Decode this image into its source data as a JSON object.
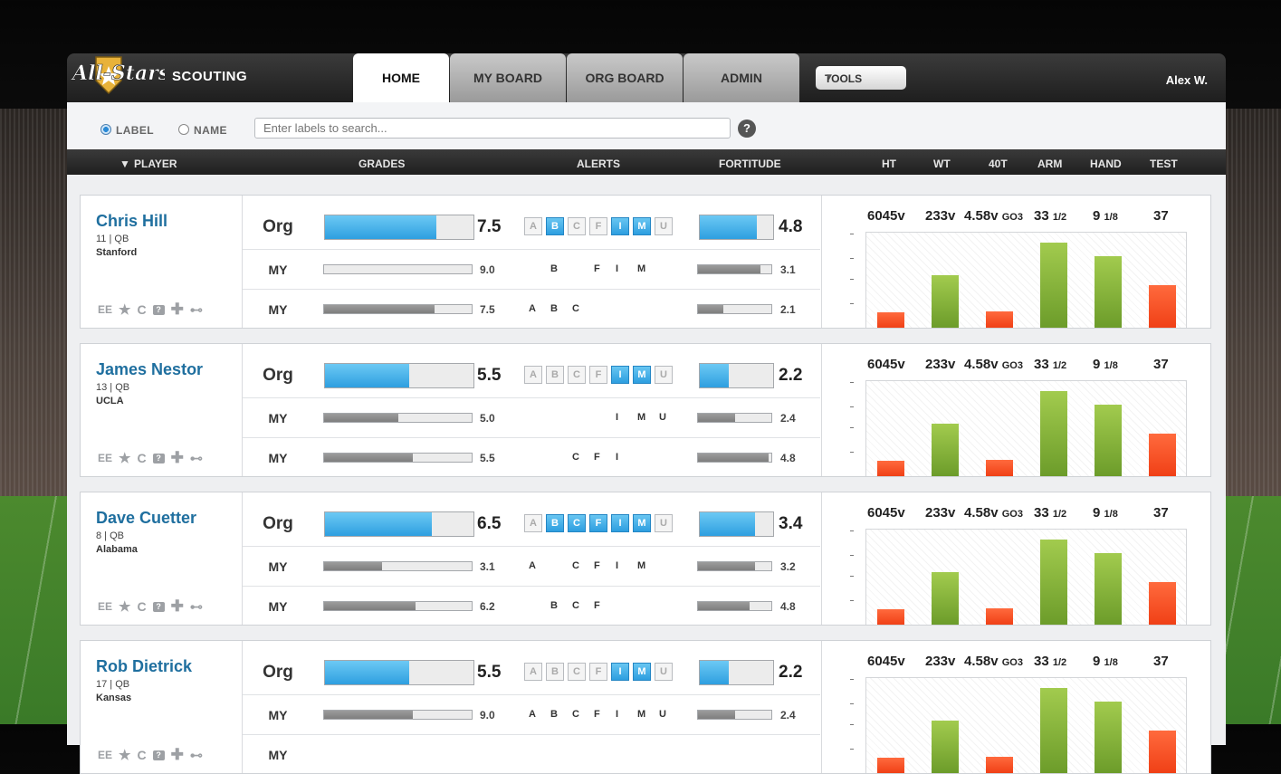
{
  "app": {
    "brand": "SCOUTING",
    "logo_text": "All-Stars",
    "user": "Alex W."
  },
  "tabs": [
    {
      "label": "HOME",
      "active": true
    },
    {
      "label": "MY BOARD",
      "active": false
    },
    {
      "label": "ORG BOARD",
      "active": false
    },
    {
      "label": "ADMIN",
      "active": false
    }
  ],
  "tools": {
    "label": "TOOLS"
  },
  "search": {
    "radio_label": "LABEL",
    "radio_name": "NAME",
    "selected": "LABEL",
    "placeholder": "Enter labels to search...",
    "help": "?"
  },
  "columns": {
    "player": "PLAYER",
    "grades": "GRADES",
    "alerts": "ALERTS",
    "fortitude": "FORTITUDE",
    "ht": "HT",
    "wt": "WT",
    "forty": "40T",
    "arm": "ARM",
    "hand": "HAND",
    "test": "TEST"
  },
  "row_labels": {
    "org": "Org",
    "my": "MY"
  },
  "player_icons": {
    "ee": "EE",
    "c": "C"
  },
  "alert_letters": [
    "A",
    "B",
    "C",
    "F",
    "I",
    "M",
    "U"
  ],
  "colors": {
    "accent_blue": "#2e9fe0",
    "bar_red": "#f04016",
    "bar_green": "#6c9c2a",
    "name_blue": "#1f6f9f"
  },
  "players": [
    {
      "name": "Chris Hill",
      "number_pos": "11 | QB",
      "school": "Stanford",
      "org": {
        "grade": "7.5",
        "grade_pct": 75,
        "alerts_on": [
          "B",
          "I",
          "M"
        ],
        "fortitude": "4.8",
        "fort_pct": 78
      },
      "my": [
        {
          "grade": "9.0",
          "grade_pct": 0,
          "letters": [
            "B",
            "F",
            "I",
            "M"
          ],
          "fortitude": "3.1",
          "fort_pct": 85
        },
        {
          "grade": "7.5",
          "grade_pct": 75,
          "letters": [
            "A",
            "B",
            "C"
          ],
          "fortitude": "2.1",
          "fort_pct": 35
        }
      ],
      "measure": {
        "ht": "6045v",
        "wt": "233v",
        "forty": "4.58v",
        "forty_tag": "GO3",
        "arm": "33",
        "arm_frac": "1/2",
        "hand": "9",
        "hand_frac": "1/8",
        "test": "37"
      },
      "chart": [
        {
          "v": 16,
          "c": "red"
        },
        {
          "v": 55,
          "c": "green"
        },
        {
          "v": 17,
          "c": "red"
        },
        {
          "v": 90,
          "c": "green"
        },
        {
          "v": 75,
          "c": "green"
        },
        {
          "v": 45,
          "c": "red"
        }
      ]
    },
    {
      "name": "James Nestor",
      "number_pos": "13 | QB",
      "school": "UCLA",
      "org": {
        "grade": "5.5",
        "grade_pct": 57,
        "alerts_on": [
          "I",
          "M"
        ],
        "fortitude": "2.2",
        "fort_pct": 40
      },
      "my": [
        {
          "grade": "5.0",
          "grade_pct": 50,
          "letters": [
            "I",
            "M",
            "U"
          ],
          "fortitude": "2.4",
          "fort_pct": 50
        },
        {
          "grade": "5.5",
          "grade_pct": 60,
          "letters": [
            "C",
            "F",
            "I"
          ],
          "fortitude": "4.8",
          "fort_pct": 96
        }
      ],
      "measure": {
        "ht": "6045v",
        "wt": "233v",
        "forty": "4.58v",
        "forty_tag": "GO3",
        "arm": "33",
        "arm_frac": "1/2",
        "hand": "9",
        "hand_frac": "1/8",
        "test": "37"
      },
      "chart": [
        {
          "v": 16,
          "c": "red"
        },
        {
          "v": 55,
          "c": "green"
        },
        {
          "v": 17,
          "c": "red"
        },
        {
          "v": 90,
          "c": "green"
        },
        {
          "v": 75,
          "c": "green"
        },
        {
          "v": 45,
          "c": "red"
        }
      ]
    },
    {
      "name": "Dave Cuetter",
      "number_pos": "8 | QB",
      "school": "Alabama",
      "org": {
        "grade": "6.5",
        "grade_pct": 72,
        "alerts_on": [
          "B",
          "C",
          "F",
          "I",
          "M"
        ],
        "fortitude": "3.4",
        "fort_pct": 75
      },
      "my": [
        {
          "grade": "3.1",
          "grade_pct": 39,
          "letters": [
            "A",
            "C",
            "F",
            "I",
            "M"
          ],
          "fortitude": "3.2",
          "fort_pct": 78
        },
        {
          "grade": "6.2",
          "grade_pct": 62,
          "letters": [
            "B",
            "C",
            "F"
          ],
          "fortitude": "4.8",
          "fort_pct": 70
        }
      ],
      "measure": {
        "ht": "6045v",
        "wt": "233v",
        "forty": "4.58v",
        "forty_tag": "GO3",
        "arm": "33",
        "arm_frac": "1/2",
        "hand": "9",
        "hand_frac": "1/8",
        "test": "37"
      },
      "chart": [
        {
          "v": 16,
          "c": "red"
        },
        {
          "v": 55,
          "c": "green"
        },
        {
          "v": 17,
          "c": "red"
        },
        {
          "v": 90,
          "c": "green"
        },
        {
          "v": 75,
          "c": "green"
        },
        {
          "v": 45,
          "c": "red"
        }
      ]
    },
    {
      "name": "Rob Dietrick",
      "number_pos": "17 | QB",
      "school": "Kansas",
      "org": {
        "grade": "5.5",
        "grade_pct": 57,
        "alerts_on": [
          "I",
          "M"
        ],
        "fortitude": "2.2",
        "fort_pct": 40
      },
      "my": [
        {
          "grade": "9.0",
          "grade_pct": 60,
          "letters": [
            "A",
            "B",
            "C",
            "F",
            "I",
            "M",
            "U"
          ],
          "fortitude": "2.4",
          "fort_pct": 50
        },
        {
          "grade": "",
          "grade_pct": 0,
          "letters": [],
          "fortitude": "",
          "fort_pct": 0
        }
      ],
      "measure": {
        "ht": "6045v",
        "wt": "233v",
        "forty": "4.58v",
        "forty_tag": "GO3",
        "arm": "33",
        "arm_frac": "1/2",
        "hand": "9",
        "hand_frac": "1/8",
        "test": "37"
      },
      "chart": [
        {
          "v": 16,
          "c": "red"
        },
        {
          "v": 55,
          "c": "green"
        },
        {
          "v": 17,
          "c": "red"
        },
        {
          "v": 90,
          "c": "green"
        },
        {
          "v": 75,
          "c": "green"
        },
        {
          "v": 45,
          "c": "red"
        }
      ]
    }
  ]
}
